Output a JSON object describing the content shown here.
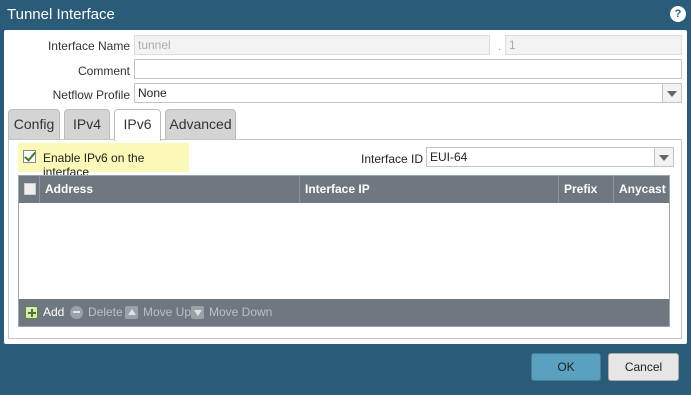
{
  "dialog": {
    "title": "Tunnel Interface",
    "help_icon": "question-mark-icon"
  },
  "form": {
    "interface_name_label": "Interface Name",
    "interface_name_value": "tunnel",
    "interface_separator": ".",
    "interface_suffix_value": "1",
    "comment_label": "Comment",
    "comment_value": "",
    "netflow_label": "Netflow Profile",
    "netflow_value": "None"
  },
  "tabs": [
    {
      "label": "Config"
    },
    {
      "label": "IPv4"
    },
    {
      "label": "IPv6",
      "active": true
    },
    {
      "label": "Advanced"
    }
  ],
  "ipv6": {
    "enable_label": "Enable IPv6 on the interface",
    "enable_checked": true,
    "interface_id_label": "Interface ID",
    "interface_id_value": "EUI-64"
  },
  "grid": {
    "columns": [
      "Address",
      "Interface IP",
      "Prefix",
      "Anycast"
    ],
    "rows": []
  },
  "grid_toolbar": {
    "add": "Add",
    "delete": "Delete",
    "move_up": "Move Up",
    "move_down": "Move Down"
  },
  "buttons": {
    "ok": "OK",
    "cancel": "Cancel"
  },
  "colors": {
    "titlebar": "#2a5b78",
    "ok_button": "#5aa0bf",
    "highlight": "#fbf8b8",
    "grid_header": "#6f7880"
  }
}
